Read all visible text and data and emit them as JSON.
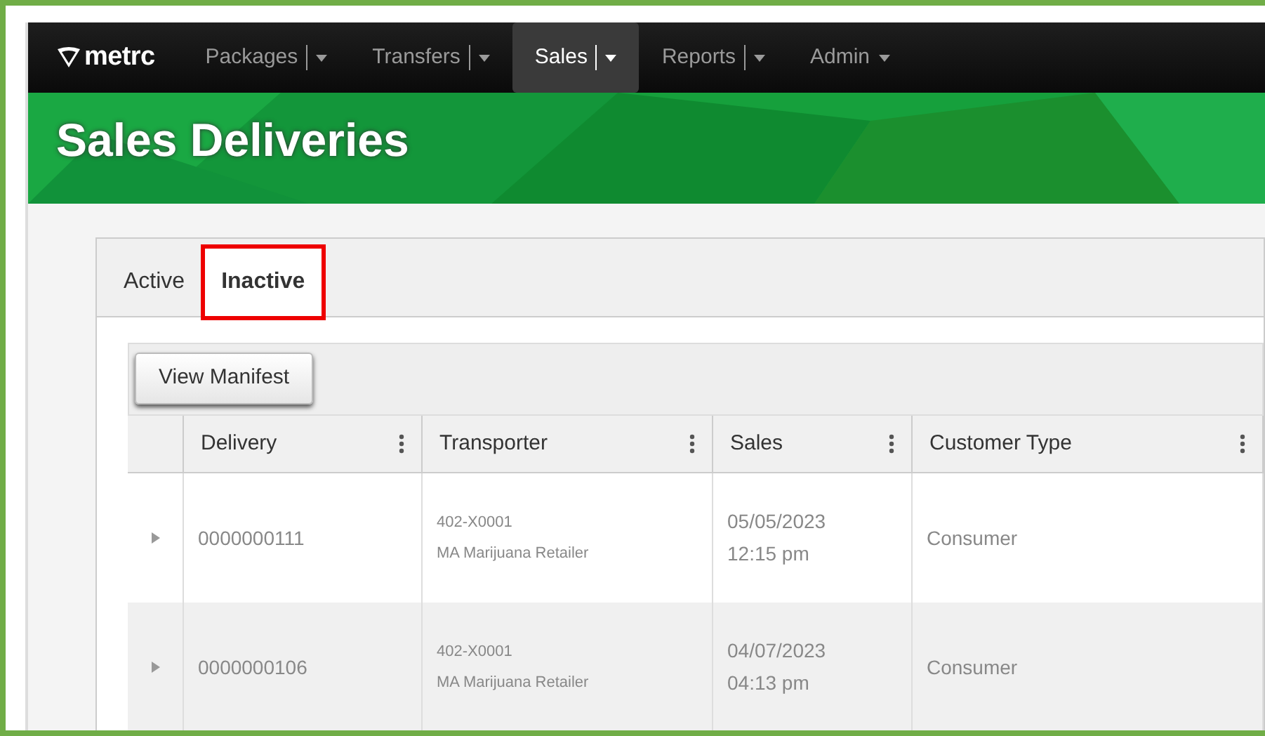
{
  "brand": "metrc",
  "nav": [
    {
      "label": "Packages",
      "split": true,
      "selected": false
    },
    {
      "label": "Transfers",
      "split": true,
      "selected": false
    },
    {
      "label": "Sales",
      "split": true,
      "selected": true
    },
    {
      "label": "Reports",
      "split": true,
      "selected": false
    },
    {
      "label": "Admin",
      "split": false,
      "selected": false
    }
  ],
  "page_title": "Sales Deliveries",
  "tabs": [
    {
      "label": "Active",
      "selected": false,
      "highlighted": false
    },
    {
      "label": "Inactive",
      "selected": true,
      "highlighted": true
    }
  ],
  "toolbar": {
    "buttons": [
      "View Manifest"
    ]
  },
  "table": {
    "columns": [
      "Delivery",
      "Transporter",
      "Sales",
      "Customer Type"
    ],
    "rows": [
      {
        "delivery": "0000000111",
        "transporter": [
          "402-X0001",
          "MA Marijuana Retailer"
        ],
        "sales": [
          "05/05/2023",
          "12:15 pm"
        ],
        "customer_type": "Consumer"
      },
      {
        "delivery": "0000000106",
        "transporter": [
          "402-X0001",
          "MA Marijuana Retailer"
        ],
        "sales": [
          "04/07/2023",
          "04:13 pm"
        ],
        "customer_type": "Consumer"
      }
    ]
  }
}
